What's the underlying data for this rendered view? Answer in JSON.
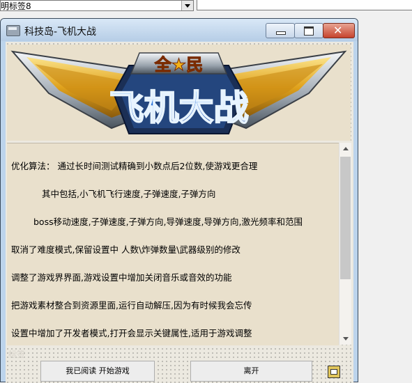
{
  "ide": {
    "combo_value": "明标签8"
  },
  "window": {
    "title": "科技岛-飞机大战"
  },
  "banner": {
    "top_text": "全★民",
    "main_text": "飞机大战"
  },
  "content": {
    "lines": [
      "优化算法： 通过长时间测试精确到小数点后2位数,使游戏更合理",
      "其中包括,小飞机飞行速度,子弹速度,子弹方向",
      "boss移动速度,子弹速度,子弹方向,导弹速度,导弹方向,激光频率和范围",
      "取消了难度模式,保留设置中 人数\\炸弹数量\\武器级别的修改",
      "调整了游戏界界面,游戏设置中增加关闭音乐或音效的功能",
      "把游戏素材整合到资源里面,运行自动解压,因为有时候我会忘传",
      "设置中增加了开发者模式,打开会显示关键属性,适用于游戏调整"
    ]
  },
  "footer": {
    "faint_label": "标签",
    "start_button": "我已阅读  开始游戏",
    "leave_button": "离开"
  },
  "colors": {
    "panel_bg": "#e9e0cc",
    "banner_blue": "#1a5fd0",
    "banner_gold": "#f2b21a"
  }
}
